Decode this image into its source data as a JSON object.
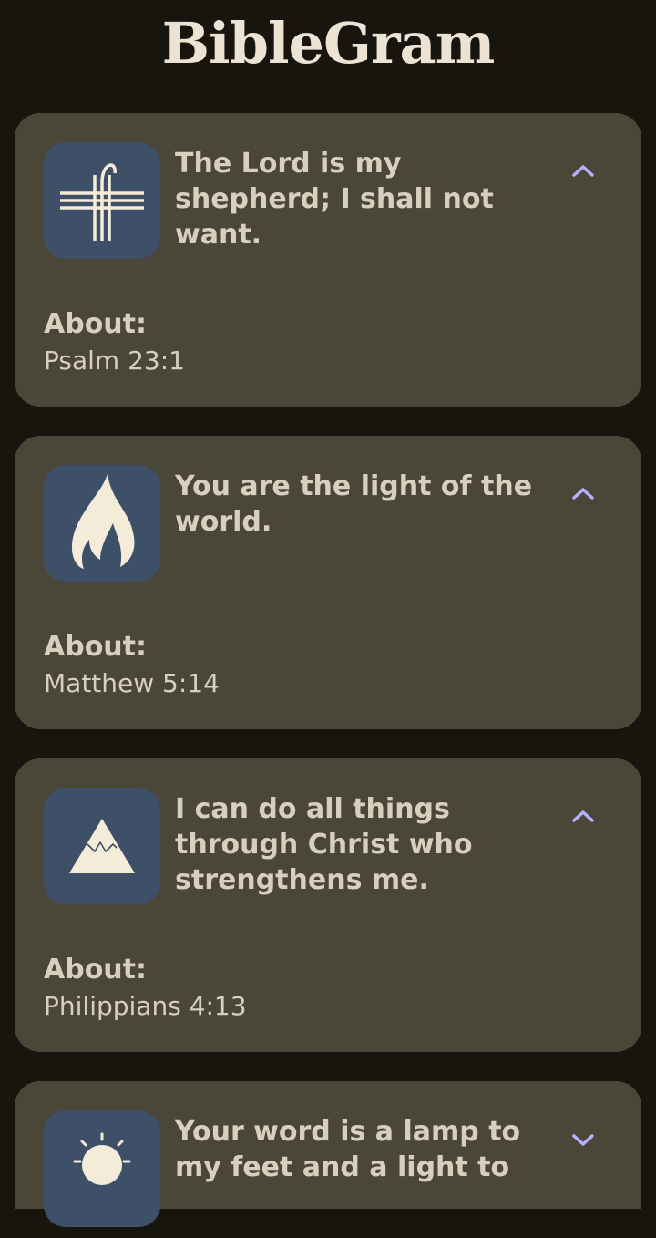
{
  "app": {
    "title": "BibleGram"
  },
  "colors": {
    "background": "#17150e",
    "card": "#4a4739",
    "icon_tile": "#3e4f68",
    "text": "#d8cfbf",
    "accent_chevron": "#b7b0ff",
    "icon_fill": "#f4ecd8"
  },
  "cards": [
    {
      "icon": "cross-icon",
      "verse": "The Lord is my shepherd; I shall not want.",
      "about_label": "About:",
      "reference": "Psalm 23:1",
      "toggle": "chevron-up-icon",
      "expanded": true
    },
    {
      "icon": "flame-icon",
      "verse": "You are the light of the world.",
      "about_label": "About:",
      "reference": "Matthew 5:14",
      "toggle": "chevron-up-icon",
      "expanded": true
    },
    {
      "icon": "mountain-icon",
      "verse": "I can do all things through Christ who strengthens me.",
      "about_label": "About:",
      "reference": "Philippians 4:13",
      "toggle": "chevron-up-icon",
      "expanded": true
    },
    {
      "icon": "lamp-icon",
      "verse": "Your word is a lamp to my feet and a light to",
      "toggle": "chevron-down-icon",
      "expanded": false
    }
  ]
}
